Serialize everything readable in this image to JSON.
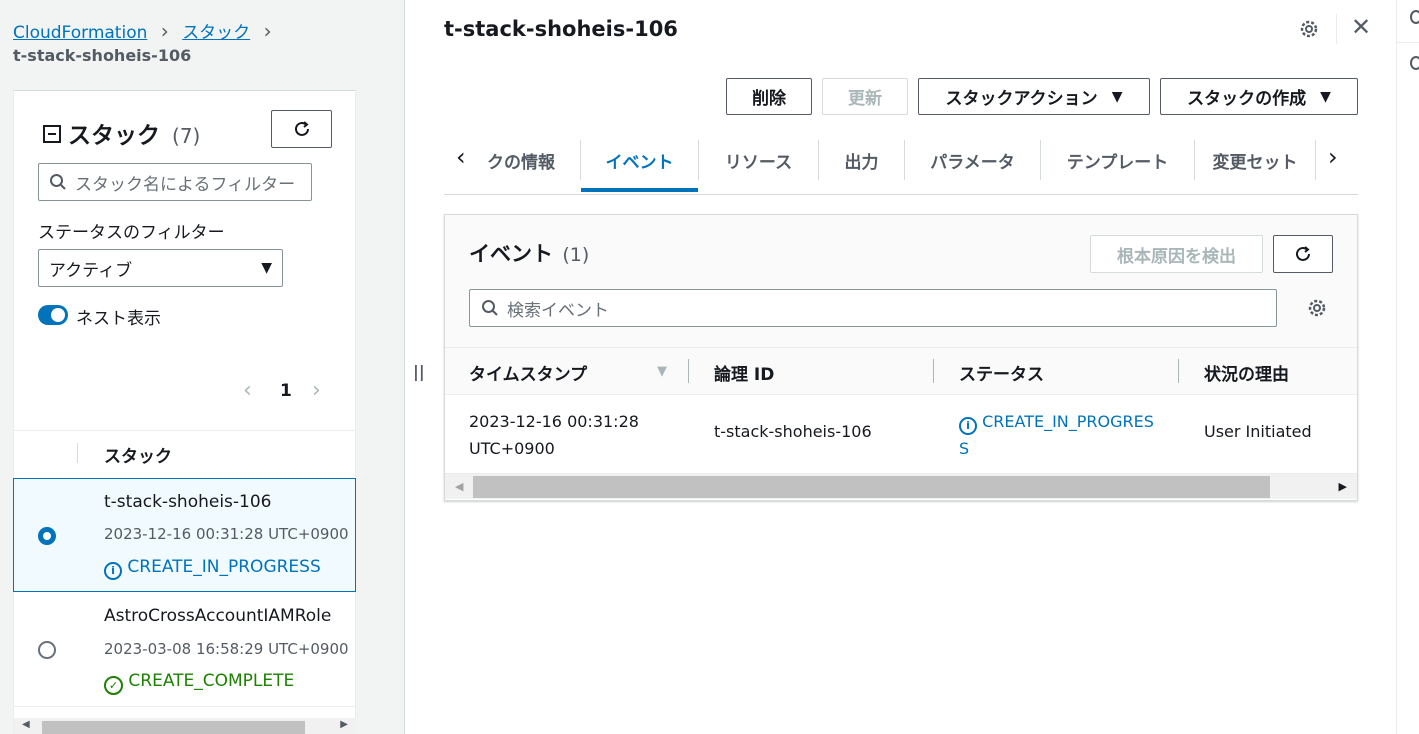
{
  "breadcrumb": {
    "item1": "CloudFormation",
    "item2": "スタック",
    "current": "t-stack-shoheis-106"
  },
  "stack_list": {
    "title": "スタック",
    "count": "(7)",
    "search_placeholder": "スタック名によるフィルター",
    "status_filter_label": "ステータスのフィルター",
    "status_filter_value": "アクティブ",
    "nested_toggle_label": "ネスト表示",
    "page_number": "1",
    "column_header": "スタック",
    "items": [
      {
        "name": "t-stack-shoheis-106",
        "date": "2023-12-16 00:31:28 UTC+0900",
        "status": "CREATE_IN_PROGRESS",
        "selected": true
      },
      {
        "name": "AstroCrossAccountIAMRole",
        "date": "2023-03-08 16:58:29 UTC+0900",
        "status": "CREATE_COMPLETE",
        "selected": false
      }
    ]
  },
  "detail": {
    "title": "t-stack-shoheis-106",
    "buttons": {
      "delete": "削除",
      "update": "更新",
      "stack_actions": "スタックアクション",
      "create_stack": "スタックの作成"
    },
    "tabs": [
      "クの情報",
      "イベント",
      "リソース",
      "出力",
      "パラメータ",
      "テンプレート",
      "変更セット"
    ],
    "active_tab": "イベント",
    "events": {
      "title": "イベント",
      "count": "(1)",
      "root_cause_button": "根本原因を検出",
      "search_placeholder": "検索イベント",
      "columns": [
        "タイムスタンプ",
        "論理 ID",
        "ステータス",
        "状況の理由"
      ],
      "rows": [
        {
          "timestamp_line1": "2023-12-16 00:31:28",
          "timestamp_line2": "UTC+0900",
          "logical_id": "t-stack-shoheis-106",
          "status_line1": "CREATE_IN_PROGRES",
          "status_line2": "S",
          "reason": "User Initiated"
        }
      ]
    }
  },
  "colors": {
    "link": "#0073bb",
    "success": "#1d8102",
    "selected_bg": "#f1faff",
    "text": "#16191f"
  }
}
